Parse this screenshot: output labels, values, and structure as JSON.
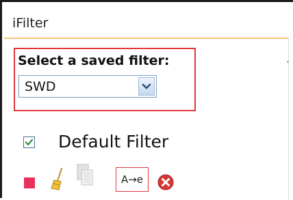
{
  "panel": {
    "title": "iFilter"
  },
  "saved_filter": {
    "label": "Select a saved filter:",
    "selected_value": "SWD"
  },
  "default_filter": {
    "label": "Default Filter",
    "checked": true
  },
  "toolbar": {
    "rename_label": "A→e",
    "icons": [
      "stop-icon",
      "broom-icon",
      "copy-icon",
      "rename-icon",
      "delete-icon"
    ]
  },
  "colors": {
    "highlight_border": "#e2353b",
    "stop_red": "#e8315a",
    "title_underline": "#f4c27a"
  }
}
